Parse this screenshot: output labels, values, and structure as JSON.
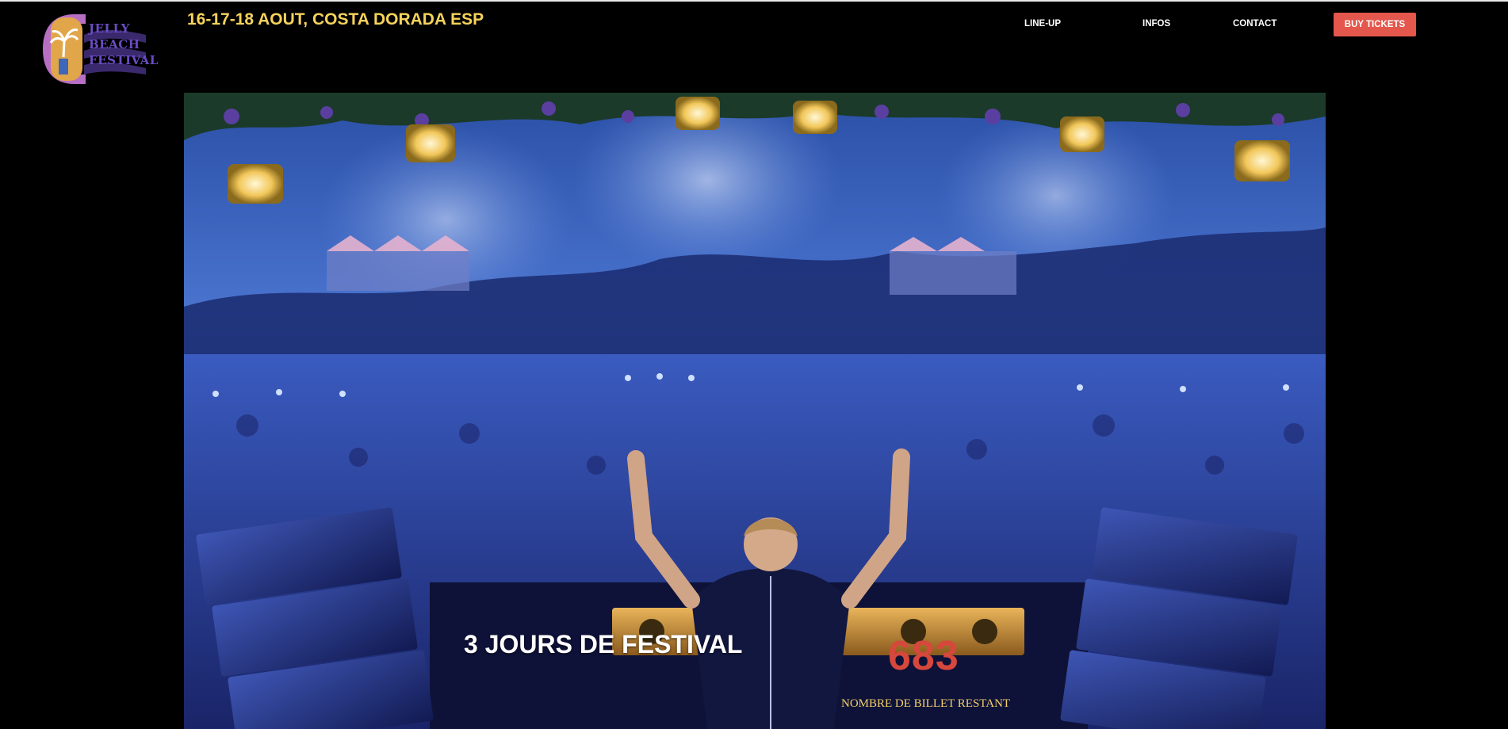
{
  "header": {
    "logo": {
      "text_lines": [
        "JELLY",
        "BEACH",
        "FESTIVAL"
      ]
    },
    "dates": "16-17-18 AOUT, COSTA DORADA ESP"
  },
  "nav": {
    "items": [
      {
        "label": "LINE-UP"
      },
      {
        "label": "INFOS"
      },
      {
        "label": "CONTACT"
      }
    ],
    "cta_label": "BUY TICKETS"
  },
  "hero": {
    "title": "3 JOURS DE FESTIVAL",
    "ticket_count": "683",
    "ticket_label": "NOMBRE DE BILLET RESTANT"
  },
  "colors": {
    "background": "#000000",
    "dates_yellow": "#f6d35b",
    "cta_red": "#e4574c",
    "count_red": "#d6473c",
    "label_gold": "#f3cf6a"
  }
}
